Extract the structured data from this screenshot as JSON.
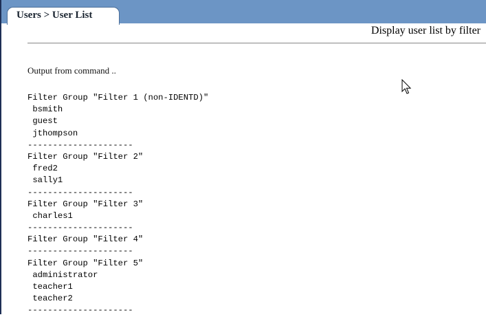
{
  "breadcrumb_tab": "Users > User List",
  "page_heading": "Display user list by filter",
  "output_label": "Output from command ..",
  "output_lines": [
    "Filter Group \"Filter 1 (non-IDENTD)\"",
    " bsmith",
    " guest",
    " jthompson",
    "---------------------",
    "Filter Group \"Filter 2\"",
    " fred2",
    " sally1",
    "---------------------",
    "Filter Group \"Filter 3\"",
    " charles1",
    "---------------------",
    "Filter Group \"Filter 4\"",
    "---------------------",
    "Filter Group \"Filter 5\"",
    " administrator",
    " teacher1",
    " teacher2",
    "---------------------"
  ],
  "icons": {
    "cursor": "mouse-pointer-icon"
  },
  "colors": {
    "header_bar": "#6c95c5",
    "frame": "#1e2f56",
    "divider": "#9a9a9a"
  }
}
